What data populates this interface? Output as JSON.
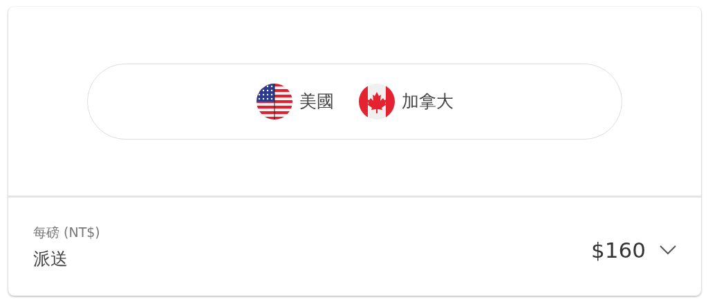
{
  "countries": [
    {
      "name": "美國",
      "kind": "us"
    },
    {
      "name": "加拿大",
      "kind": "ca"
    }
  ],
  "rate": {
    "label": "每磅 (NT$)",
    "method": "派送",
    "price": "$160"
  }
}
